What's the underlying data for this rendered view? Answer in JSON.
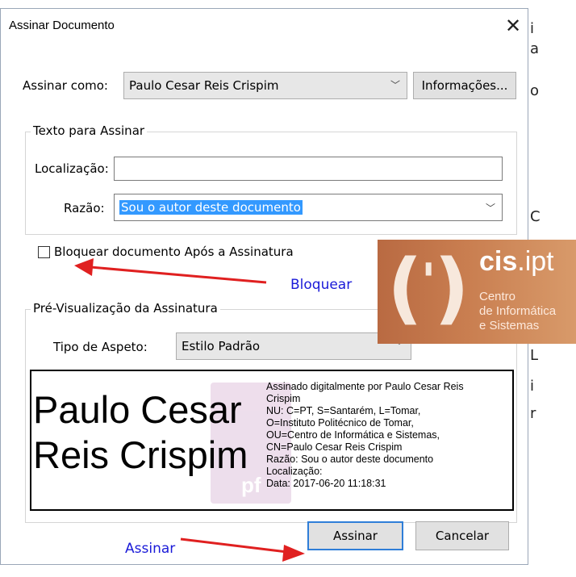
{
  "background": {
    "side_fragments": [
      "i",
      "a",
      "o",
      "C",
      "L",
      "i",
      "r"
    ]
  },
  "dialog": {
    "title": "Assinar Documento",
    "close_glyph": "✕",
    "sign_as": {
      "label": "Assinar como:",
      "value": "Paulo Cesar Reis Crispim",
      "info_button": "Informações..."
    },
    "text_group": {
      "title": "Texto para Assinar",
      "location_label": "Localização:",
      "location_value": "",
      "reason_label": "Razão:",
      "reason_value": "Sou o autor deste documento"
    },
    "lock_checkbox": {
      "label": "Bloquear documento Após a Assinatura",
      "checked": false
    },
    "preview_group": {
      "title": "Pré-Visualização da Assinatura",
      "appearance_label": "Tipo de Aspeto:",
      "appearance_value": "Estilo Padrão",
      "signature_name_line1": "Paulo Cesar",
      "signature_name_line2": "Reis Crispim",
      "details": [
        "Assinado digitalmente por Paulo Cesar Reis",
        "Crispim",
        "NU: C=PT, S=Santarém, L=Tomar,",
        "O=Instituto Politécnico de Tomar,",
        "OU=Centro de Informática e Sistemas,",
        "CN=Paulo Cesar Reis Crispim",
        "Razão: Sou o autor deste documento",
        "Localização:",
        "Data: 2017-06-20 11:18:31"
      ],
      "watermark_letter": "pf"
    },
    "buttons": {
      "sign": "Assinar",
      "cancel": "Cancelar"
    }
  },
  "logo": {
    "brand_bold": "cis",
    "brand_rest": ".ipt",
    "line1": "Centro",
    "line2": "de Informática",
    "line3": "e Sistemas"
  },
  "annotations": {
    "lock": "Bloquear",
    "sign": "Assinar",
    "arrow_color": "#e02020",
    "text_color": "#1a1ad8"
  }
}
